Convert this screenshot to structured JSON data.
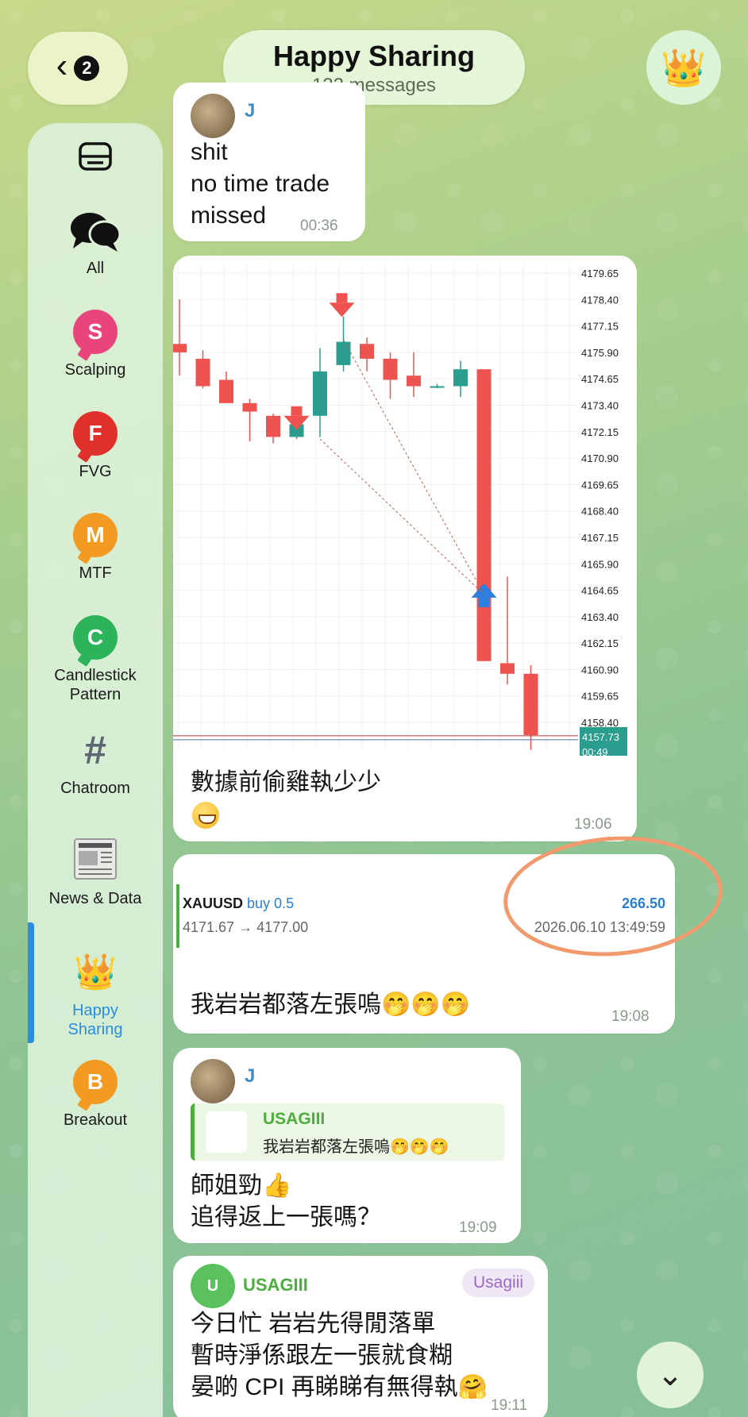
{
  "header": {
    "back_badge": "2",
    "title": "Happy Sharing",
    "subtitle": "122 messages",
    "avatar_icon": "crown-icon"
  },
  "sidebar": {
    "items": [
      {
        "label": "",
        "icon": "inbox-icon"
      },
      {
        "label": "All",
        "icon": "chat-bubbles-icon"
      },
      {
        "label": "Scalping",
        "letter": "S",
        "color": "#e8457c"
      },
      {
        "label": "FVG",
        "letter": "F",
        "color": "#e0302a"
      },
      {
        "label": "MTF",
        "letter": "M",
        "color": "#f29a21"
      },
      {
        "label": "Candlestick Pattern",
        "letter": "C",
        "color": "#2db35a"
      },
      {
        "label": "Chatroom",
        "icon": "hashtag-icon"
      },
      {
        "label": "News & Data",
        "icon": "newspaper-icon"
      },
      {
        "label": "Happy Sharing",
        "icon": "crown-icon",
        "active": true
      },
      {
        "label": "Breakout",
        "letter": "B",
        "color": "#f29a21"
      }
    ]
  },
  "messages": {
    "m1": {
      "sender": "J",
      "lines": [
        "shit",
        "no time trade",
        "missed"
      ],
      "time": "00:36"
    },
    "m2": {
      "caption": "數據前偷雞執少少",
      "time": "19:06"
    },
    "m3": {
      "symbol": "XAUUSD",
      "side": "buy 0.5",
      "prices": "4171.67 → 4177.00",
      "profit": "266.50",
      "datetime": "2026.06.10 13:49:59",
      "text": "我岩岩都落左張嗚🤭🤭🤭",
      "time": "19:08"
    },
    "m4": {
      "sender": "J",
      "reply_name": "USAGIII",
      "reply_text": "我岩岩都落左張嗚🤭🤭🤭",
      "lines": [
        "師姐勁👍",
        "追得返上一張嗎？"
      ],
      "time": "19:09"
    },
    "m5": {
      "avatar_letter": "U",
      "sender": "USAGIII",
      "tag": "Usagiii",
      "lines": [
        "今日忙 岩岩先得閒落單",
        "暫時淨係跟左一張就食糊",
        "晏啲 CPI 再睇睇有無得執🤗"
      ],
      "time": "19:11"
    }
  },
  "chart_data": {
    "type": "candlestick",
    "y_ticks": [
      "4179.65",
      "4178.40",
      "4177.15",
      "4175.90",
      "4174.65",
      "4173.40",
      "4172.15",
      "4170.90",
      "4169.65",
      "4168.40",
      "4167.15",
      "4165.90",
      "4164.65",
      "4163.40",
      "4162.15",
      "4160.90",
      "4159.65",
      "4158.40"
    ],
    "ylim": [
      4157.2,
      4180.1
    ],
    "current_price": "4157.73",
    "timer": "00:49",
    "candles": [
      {
        "o": 4175.9,
        "h": 4178.4,
        "l": 4174.8,
        "c": 4176.3,
        "dir": "down"
      },
      {
        "o": 4175.6,
        "h": 4176.0,
        "l": 4174.2,
        "c": 4174.3,
        "dir": "down"
      },
      {
        "o": 4174.6,
        "h": 4175.0,
        "l": 4173.5,
        "c": 4173.5,
        "dir": "down"
      },
      {
        "o": 4173.5,
        "h": 4173.7,
        "l": 4171.7,
        "c": 4173.1,
        "dir": "down"
      },
      {
        "o": 4172.9,
        "h": 4173.0,
        "l": 4171.6,
        "c": 4171.9,
        "dir": "down"
      },
      {
        "o": 4171.9,
        "h": 4172.6,
        "l": 4171.8,
        "c": 4172.5,
        "dir": "up"
      },
      {
        "o": 4172.9,
        "h": 4176.1,
        "l": 4171.9,
        "c": 4175.0,
        "dir": "up"
      },
      {
        "o": 4175.3,
        "h": 4177.6,
        "l": 4175.0,
        "c": 4176.4,
        "dir": "up"
      },
      {
        "o": 4176.3,
        "h": 4176.6,
        "l": 4175.0,
        "c": 4175.6,
        "dir": "down"
      },
      {
        "o": 4175.6,
        "h": 4175.9,
        "l": 4173.7,
        "c": 4174.6,
        "dir": "down"
      },
      {
        "o": 4174.8,
        "h": 4175.9,
        "l": 4173.8,
        "c": 4174.3,
        "dir": "down"
      },
      {
        "o": 4174.3,
        "h": 4174.4,
        "l": 4174.2,
        "c": 4174.3,
        "dir": "flat"
      },
      {
        "o": 4174.3,
        "h": 4175.5,
        "l": 4173.8,
        "c": 4175.1,
        "dir": "up"
      },
      {
        "o": 4175.1,
        "h": 4175.1,
        "l": 4161.3,
        "c": 4161.3,
        "dir": "down"
      },
      {
        "o": 4161.2,
        "h": 4165.3,
        "l": 4160.2,
        "c": 4160.7,
        "dir": "down"
      },
      {
        "o": 4160.7,
        "h": 4161.1,
        "l": 4157.1,
        "c": 4157.8,
        "dir": "down"
      }
    ],
    "colors": {
      "up": "#2a9d8f",
      "down": "#ef5350",
      "flat": "#2a9d8f"
    }
  }
}
